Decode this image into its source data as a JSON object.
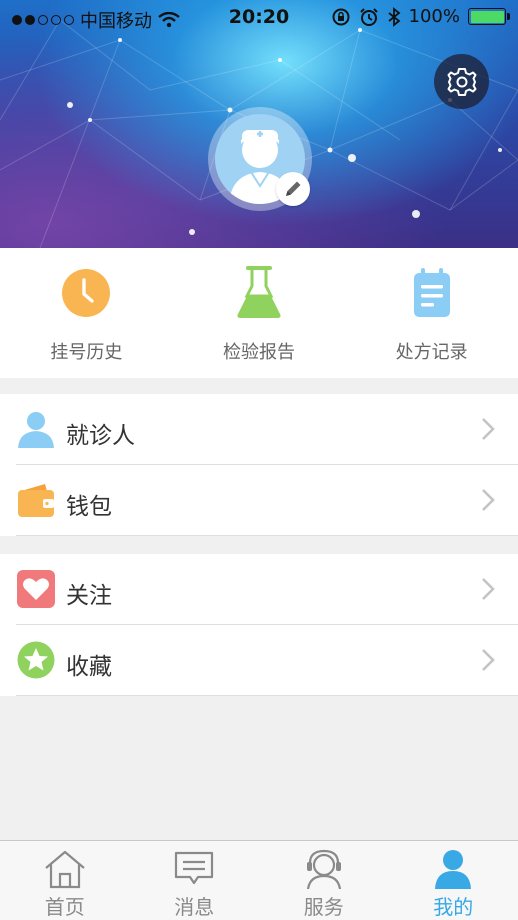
{
  "status_bar": {
    "carrier": "中国移动",
    "time": "20:20",
    "battery": "100%"
  },
  "header": {
    "settings_icon": "gear-icon",
    "avatar_icon": "doctor-avatar-icon",
    "edit_icon": "pencil-icon"
  },
  "quick_actions": [
    {
      "label": "挂号历史",
      "icon": "clock-icon",
      "color": "#f9b552"
    },
    {
      "label": "检验报告",
      "icon": "flask-icon",
      "color": "#8fd35e"
    },
    {
      "label": "处方记录",
      "icon": "notepad-icon",
      "color": "#8ccdf5"
    }
  ],
  "menu_group_1": [
    {
      "label": "就诊人",
      "icon": "person-icon",
      "color": "#8ccdf5"
    },
    {
      "label": "钱包",
      "icon": "wallet-icon",
      "color": "#f9b552"
    }
  ],
  "menu_group_2": [
    {
      "label": "关注",
      "icon": "heart-icon",
      "color": "#f0797b"
    },
    {
      "label": "收藏",
      "icon": "star-icon",
      "color": "#8fd35e"
    }
  ],
  "tabbar": [
    {
      "label": "首页",
      "icon": "home-icon",
      "active": false
    },
    {
      "label": "消息",
      "icon": "message-icon",
      "active": false
    },
    {
      "label": "服务",
      "icon": "customer-service-icon",
      "active": false
    },
    {
      "label": "我的",
      "icon": "profile-icon",
      "active": true
    }
  ],
  "colors": {
    "accent": "#38a9e4",
    "background": "#f0f0f0"
  }
}
